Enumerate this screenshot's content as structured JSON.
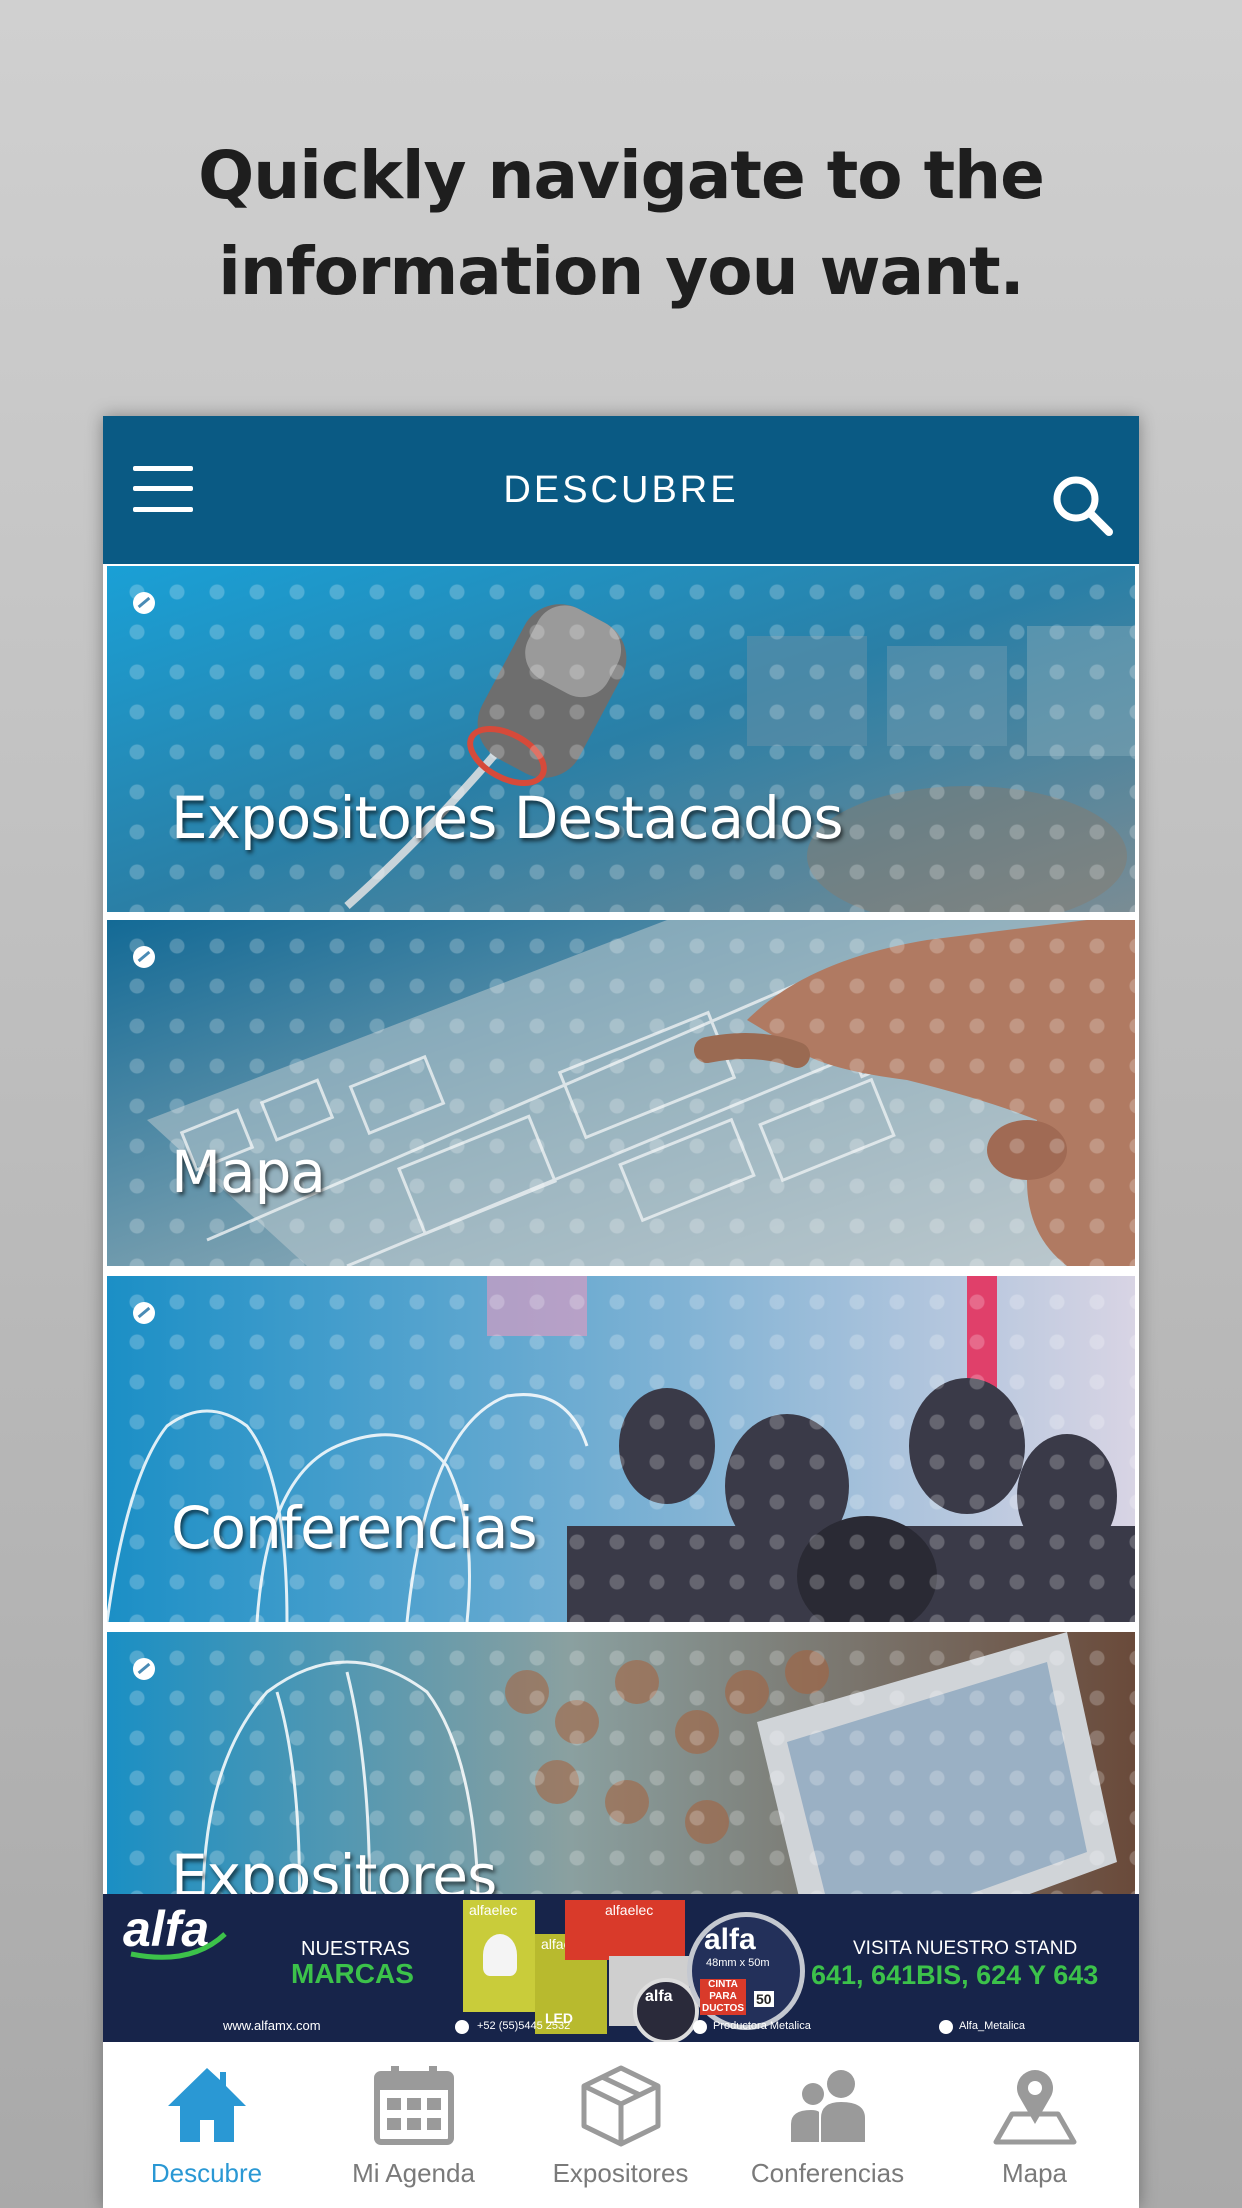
{
  "headline": {
    "line1": "Quickly navigate to the",
    "line2": "information you want."
  },
  "navbar": {
    "title": "DESCUBRE",
    "color": "#0a5a84"
  },
  "cards": [
    {
      "label": "Expositores Destacados"
    },
    {
      "label": "Mapa"
    },
    {
      "label": "Conferencias"
    },
    {
      "label": "Expositores"
    }
  ],
  "ad": {
    "brand": "alfa",
    "nuestras": "NUESTRAS",
    "marcas": "MARCAS",
    "visita": "VISITA NUESTRO STAND",
    "stand": "641, 641BIS, 624 Y 643",
    "website": "www.alfamx.com",
    "phone": "+52 (55)5445 2532",
    "facebook": "Productora Metalica",
    "twitter": "Alfa_Metalica",
    "product_brand": "alfaelec",
    "tape_brand": "alfa",
    "tape_size": "48mm x 50m",
    "tape_label": "CINTA PARA DUCTOS",
    "tape_count": "50",
    "led": "LED"
  },
  "tabs": [
    {
      "label": "Descubre",
      "icon": "home-icon",
      "active": true
    },
    {
      "label": "Mi Agenda",
      "icon": "calendar-icon",
      "active": false
    },
    {
      "label": "Expositores",
      "icon": "box-icon",
      "active": false
    },
    {
      "label": "Conferencias",
      "icon": "people-icon",
      "active": false
    },
    {
      "label": "Mapa",
      "icon": "map-pin-icon",
      "active": false
    }
  ],
  "colors": {
    "accent": "#2a98d4",
    "inactive": "#7a7a7a",
    "ad_background": "#17244a",
    "ad_green": "#3cc24a"
  }
}
